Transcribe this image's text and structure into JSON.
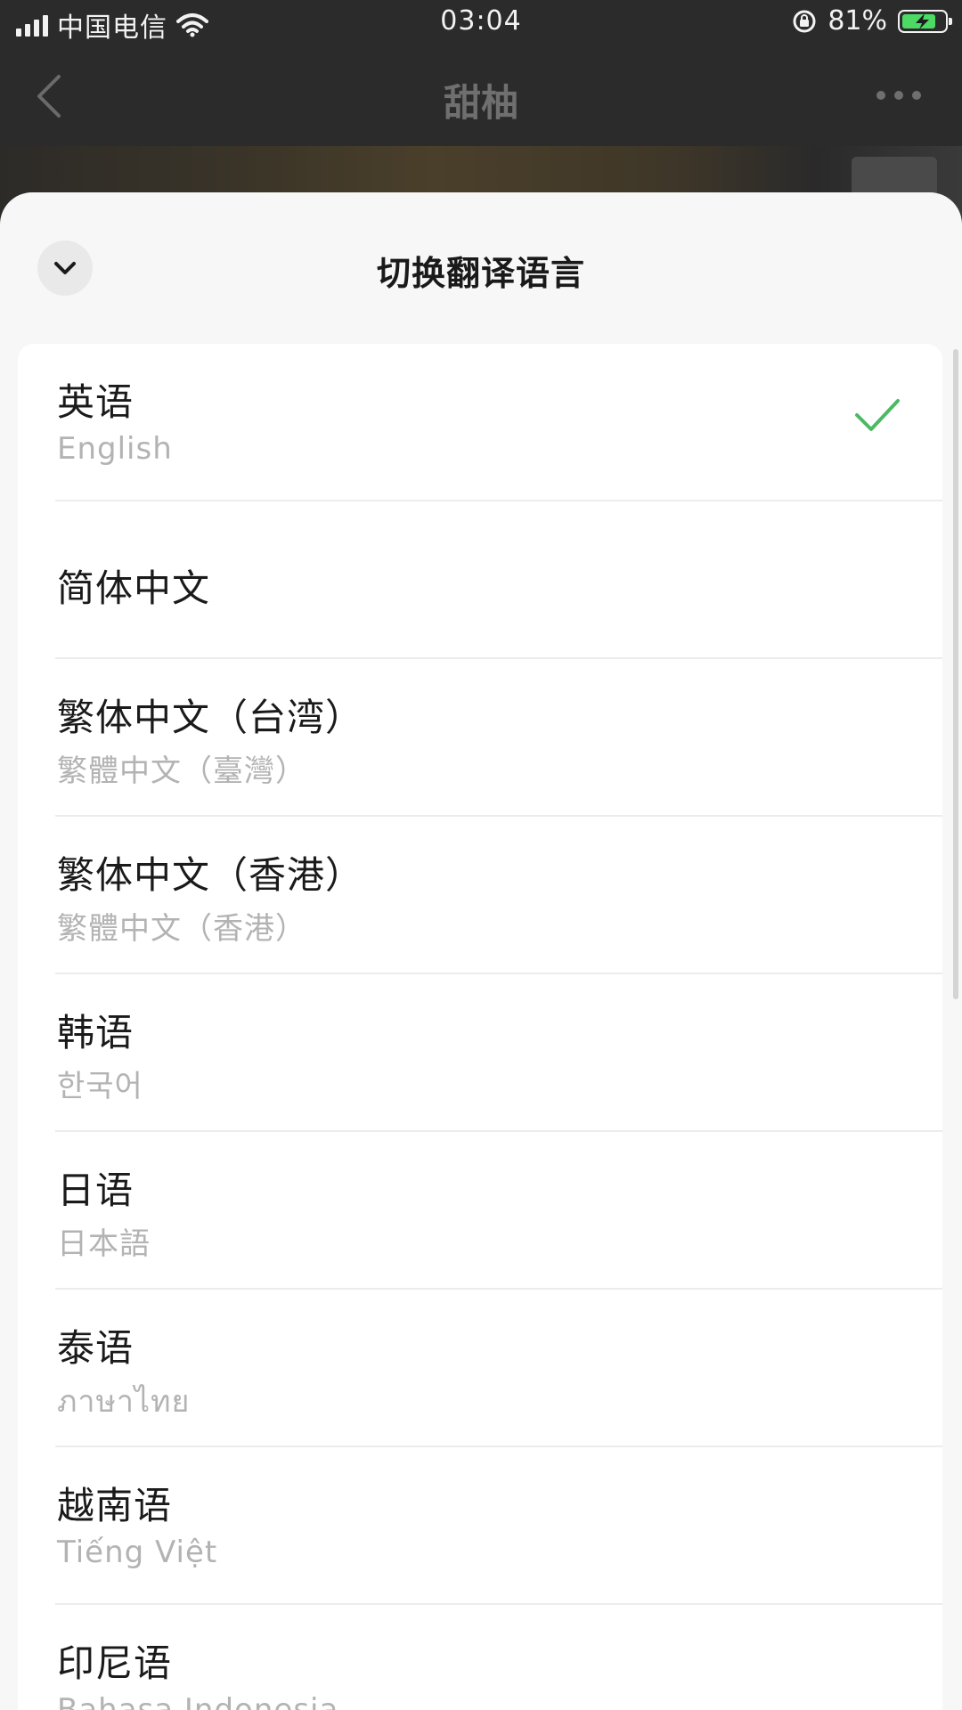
{
  "status_bar": {
    "carrier": "中国电信",
    "time": "03:04",
    "battery_percent": "81%",
    "battery_level": 0.81,
    "icons": [
      "signal-icon",
      "wifi-icon",
      "rotation-lock-icon",
      "battery-charging-icon"
    ]
  },
  "background_header": {
    "title": "甜柚",
    "back_icon": "chevron-left-icon",
    "more_icon": "more-icon"
  },
  "sheet": {
    "title": "切换翻译语言",
    "collapse_icon": "chevron-down-icon",
    "accent_color": "#4cb964",
    "languages": [
      {
        "name": "英语",
        "native": "English",
        "selected": true
      },
      {
        "name": "简体中文",
        "native": "",
        "selected": false
      },
      {
        "name": "繁体中文（台湾）",
        "native": "繁體中文（臺灣）",
        "selected": false
      },
      {
        "name": "繁体中文（香港）",
        "native": "繁體中文（香港）",
        "selected": false
      },
      {
        "name": "韩语",
        "native": "한국어",
        "selected": false
      },
      {
        "name": "日语",
        "native": "日本語",
        "selected": false
      },
      {
        "name": "泰语",
        "native": "ภาษาไทย",
        "selected": false
      },
      {
        "name": "越南语",
        "native": "Tiếng Việt",
        "selected": false
      },
      {
        "name": "印尼语",
        "native": "Bahasa Indonesia",
        "selected": false
      }
    ]
  }
}
